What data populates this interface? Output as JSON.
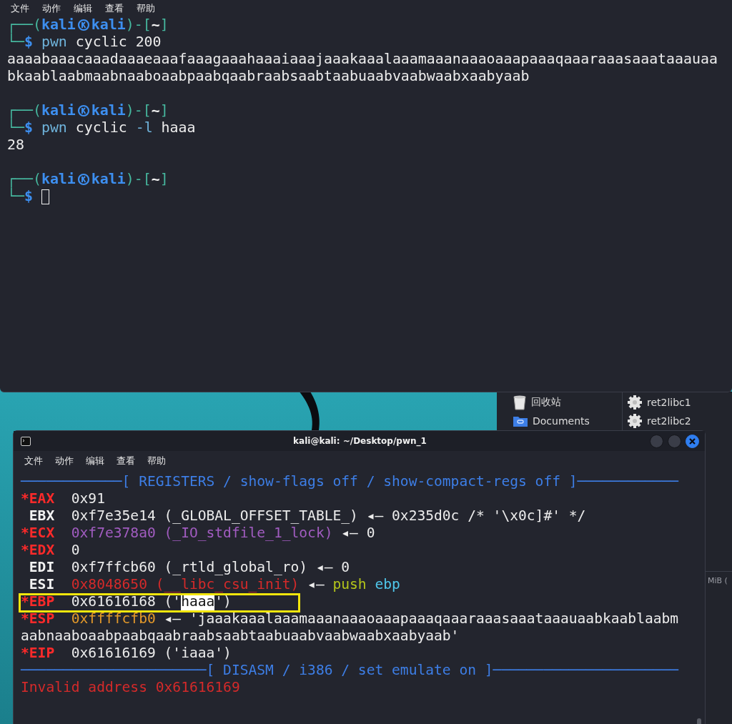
{
  "top_window": {
    "menu": [
      "文件",
      "动作",
      "编辑",
      "查看",
      "帮助"
    ],
    "blocks": [
      {
        "lines": [
          {
            "segments": [
              {
                "kind": "frame",
                "text": "┌──("
              },
              {
                "kind": "user",
                "text": "kali"
              },
              {
                "kind": "symbol"
              },
              {
                "kind": "user",
                "text": "kali"
              },
              {
                "kind": "frame",
                "text": ")-["
              },
              {
                "kind": "path",
                "text": "~"
              },
              {
                "kind": "frame",
                "text": "]"
              }
            ]
          },
          {
            "segments": [
              {
                "kind": "frame",
                "text": "└─"
              },
              {
                "kind": "prompt",
                "text": "$"
              },
              {
                "kind": "command",
                "text": " pwn"
              },
              {
                "kind": "output",
                "text": " cyclic 200"
              }
            ]
          },
          {
            "segments": [
              {
                "kind": "output",
                "text": "aaaabaaacaaadaaaeaaafaaagaaahaaaiaaajaaakaaalaaamaaanaaaoaaapaaaqaaaraaasaaataaauaa"
              }
            ]
          },
          {
            "segments": [
              {
                "kind": "output",
                "text": "bkaablaabmaabnaaboaabpaabqaabraabsaabtaabuaabvaabwaabxaabyaab"
              }
            ]
          }
        ]
      },
      {
        "lines": [
          {
            "segments": [
              {
                "kind": "frame",
                "text": "┌──("
              },
              {
                "kind": "user",
                "text": "kali"
              },
              {
                "kind": "symbol"
              },
              {
                "kind": "user",
                "text": "kali"
              },
              {
                "kind": "frame",
                "text": ")-["
              },
              {
                "kind": "path",
                "text": "~"
              },
              {
                "kind": "frame",
                "text": "]"
              }
            ]
          },
          {
            "segments": [
              {
                "kind": "frame",
                "text": "└─"
              },
              {
                "kind": "prompt",
                "text": "$"
              },
              {
                "kind": "command",
                "text": " pwn"
              },
              {
                "kind": "output",
                "text": " cyclic "
              },
              {
                "kind": "command",
                "text": "-l"
              },
              {
                "kind": "output",
                "text": " haaa"
              }
            ]
          },
          {
            "segments": [
              {
                "kind": "output",
                "text": "28"
              }
            ]
          }
        ]
      },
      {
        "lines": [
          {
            "segments": [
              {
                "kind": "frame",
                "text": "┌──("
              },
              {
                "kind": "user",
                "text": "kali"
              },
              {
                "kind": "symbol"
              },
              {
                "kind": "user",
                "text": "kali"
              },
              {
                "kind": "frame",
                "text": ")-["
              },
              {
                "kind": "path",
                "text": "~"
              },
              {
                "kind": "frame",
                "text": "]"
              }
            ]
          },
          {
            "segments": [
              {
                "kind": "frame",
                "text": "└─"
              },
              {
                "kind": "prompt",
                "text": "$"
              },
              {
                "kind": "cursor"
              }
            ]
          }
        ]
      }
    ]
  },
  "file_manager": {
    "places": [
      {
        "kind": "trash",
        "label": "回收站"
      },
      {
        "kind": "folder",
        "label": "Documents"
      }
    ],
    "files": [
      {
        "kind": "gear",
        "label": "ret2libc1"
      },
      {
        "kind": "gear",
        "label": "ret2libc2"
      }
    ],
    "status_text": "MiB ("
  },
  "bottom_window": {
    "title": "kali@kali: ~/Desktop/pwn_1",
    "menu": [
      "文件",
      "动作",
      "编辑",
      "查看",
      "帮助"
    ],
    "lines": [
      {
        "highlighted": false,
        "segments": [
          {
            "kind": "header",
            "text": "────────────[ REGISTERS / show-flags off / show-compact-regs off ]────────────"
          }
        ]
      },
      {
        "highlighted": false,
        "segments": [
          {
            "kind": "modified",
            "text": "*EAX"
          },
          {
            "kind": "output",
            "text": "  0x91"
          }
        ]
      },
      {
        "highlighted": false,
        "segments": [
          {
            "kind": "register",
            "text": " EBX"
          },
          {
            "kind": "output",
            "text": "  0xf7e35e14 (_GLOBAL_OFFSET_TABLE_) ◂— 0x235d0c /* '\\x0c]#' */"
          }
        ]
      },
      {
        "highlighted": false,
        "segments": [
          {
            "kind": "modified",
            "text": "*ECX"
          },
          {
            "kind": "data",
            "text": "  0xf7e378a0 (_IO_stdfile_1_lock)"
          },
          {
            "kind": "output",
            "text": " ◂— 0"
          }
        ]
      },
      {
        "highlighted": false,
        "segments": [
          {
            "kind": "modified",
            "text": "*EDX"
          },
          {
            "kind": "output",
            "text": "  0"
          }
        ]
      },
      {
        "highlighted": false,
        "segments": [
          {
            "kind": "register",
            "text": " EDI"
          },
          {
            "kind": "output",
            "text": "  0xf7ffcb60 (_rtld_global_ro) ◂— 0"
          }
        ]
      },
      {
        "highlighted": false,
        "segments": [
          {
            "kind": "register",
            "text": " ESI"
          },
          {
            "kind": "code",
            "text": "  0x8048650 (__libc_csu_init)"
          },
          {
            "kind": "output",
            "text": " ◂— "
          },
          {
            "kind": "instruction",
            "text": "push"
          },
          {
            "kind": "operand",
            "text": " ebp"
          }
        ]
      },
      {
        "highlighted": true,
        "segments": [
          {
            "kind": "modified",
            "text": "*EBP"
          },
          {
            "kind": "output",
            "text": "  0x61616168 ('"
          },
          {
            "kind": "selection",
            "text": "haaa"
          },
          {
            "kind": "output",
            "text": "')"
          }
        ]
      },
      {
        "highlighted": false,
        "segments": [
          {
            "kind": "modified",
            "text": "*ESP"
          },
          {
            "kind": "stack",
            "text": "  0xffffcfb0"
          },
          {
            "kind": "output",
            "text": " ◂— 'jaaakaaalaaamaaanaaaoaaapaaaqaaaraaasaaataaauaabkaablaabm"
          }
        ]
      },
      {
        "highlighted": false,
        "segments": [
          {
            "kind": "output",
            "text": "aabnaaboaabpaabqaabraabsaabtaabuaabvaabwaabxaabyaab'"
          }
        ]
      },
      {
        "highlighted": false,
        "segments": [
          {
            "kind": "modified",
            "text": "*EIP"
          },
          {
            "kind": "output",
            "text": "  0x61616169 ('iaaa')"
          }
        ]
      },
      {
        "highlighted": false,
        "segments": [
          {
            "kind": "header",
            "text": "──────────────────────[ DISASM / i386 / set emulate on ]──────────────────────"
          }
        ]
      },
      {
        "highlighted": false,
        "segments": [
          {
            "kind": "error",
            "text": "Invalid address 0x61616169"
          }
        ]
      }
    ]
  }
}
